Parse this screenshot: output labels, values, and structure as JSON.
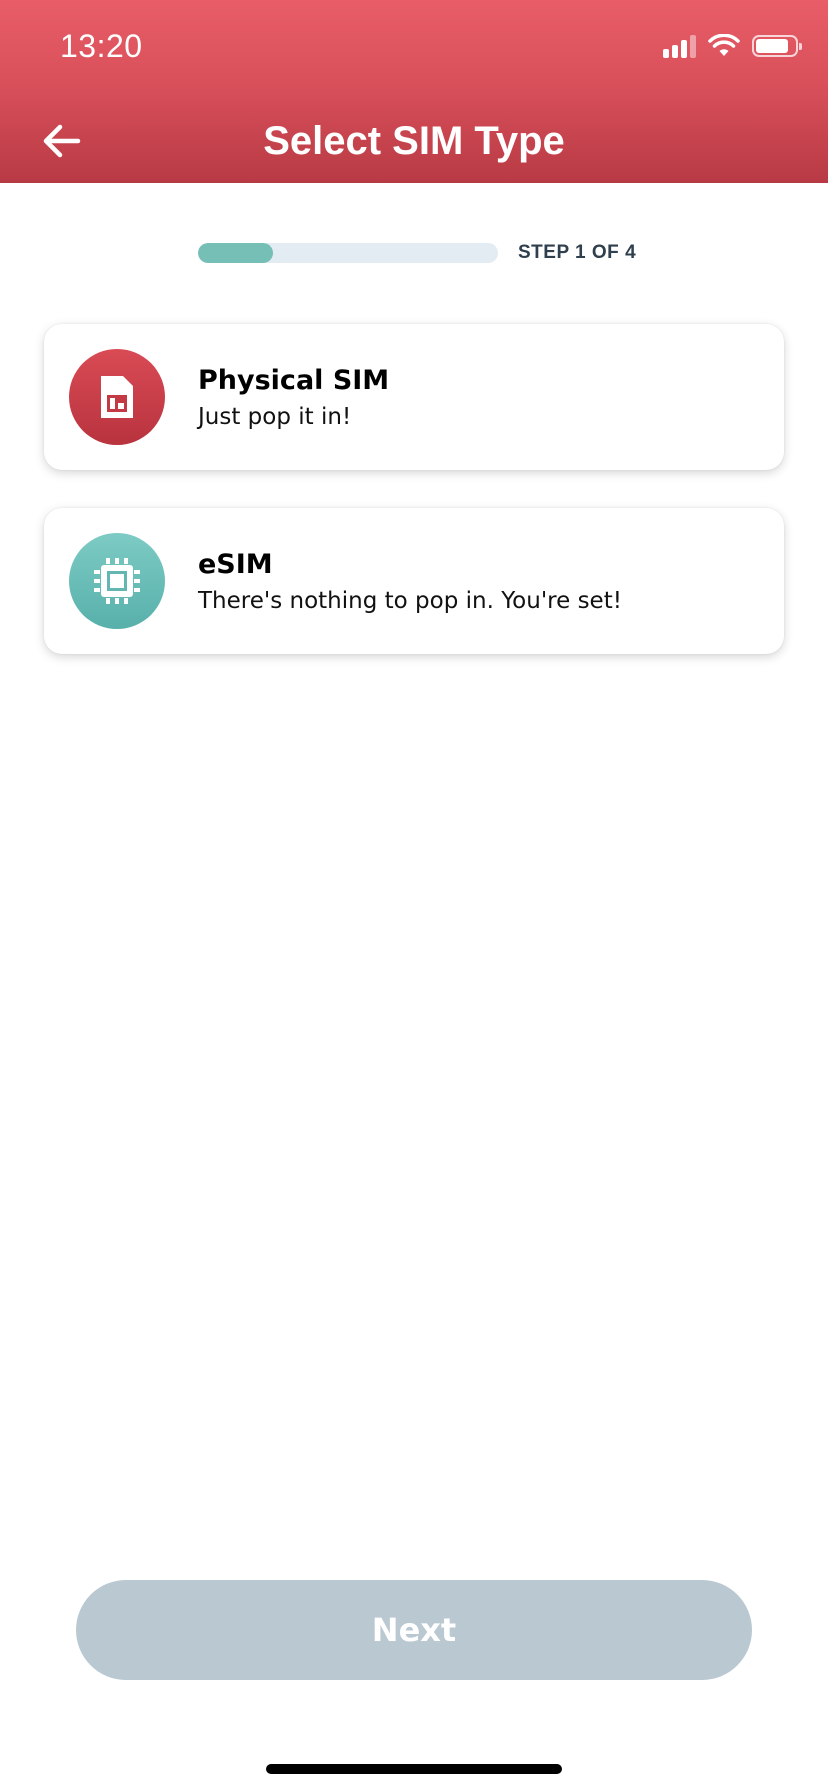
{
  "status_bar": {
    "time": "13:20",
    "icons": [
      "cellular-signal-icon",
      "wifi-icon",
      "battery-icon"
    ],
    "battery_level": 0.85
  },
  "header": {
    "title": "Select SIM Type",
    "back_icon": "arrow-left-icon",
    "colors": {
      "top": "#e85d67",
      "bottom": "#b83a44"
    }
  },
  "progress": {
    "label": "STEP 1 OF 4",
    "fraction": 0.25,
    "fill_color": "#76bfb6",
    "track_color": "#e3ebf3"
  },
  "options": [
    {
      "title": "Physical SIM",
      "subtitle": "Just pop it in!",
      "icon": "sim-card-icon",
      "icon_color": "#c8414b"
    },
    {
      "title": "eSIM",
      "subtitle": "There's nothing to pop in. You're set!",
      "icon": "chip-icon",
      "icon_color": "#6bbfb9"
    }
  ],
  "footer": {
    "next_label": "Next",
    "next_color": "#bac8d2"
  }
}
